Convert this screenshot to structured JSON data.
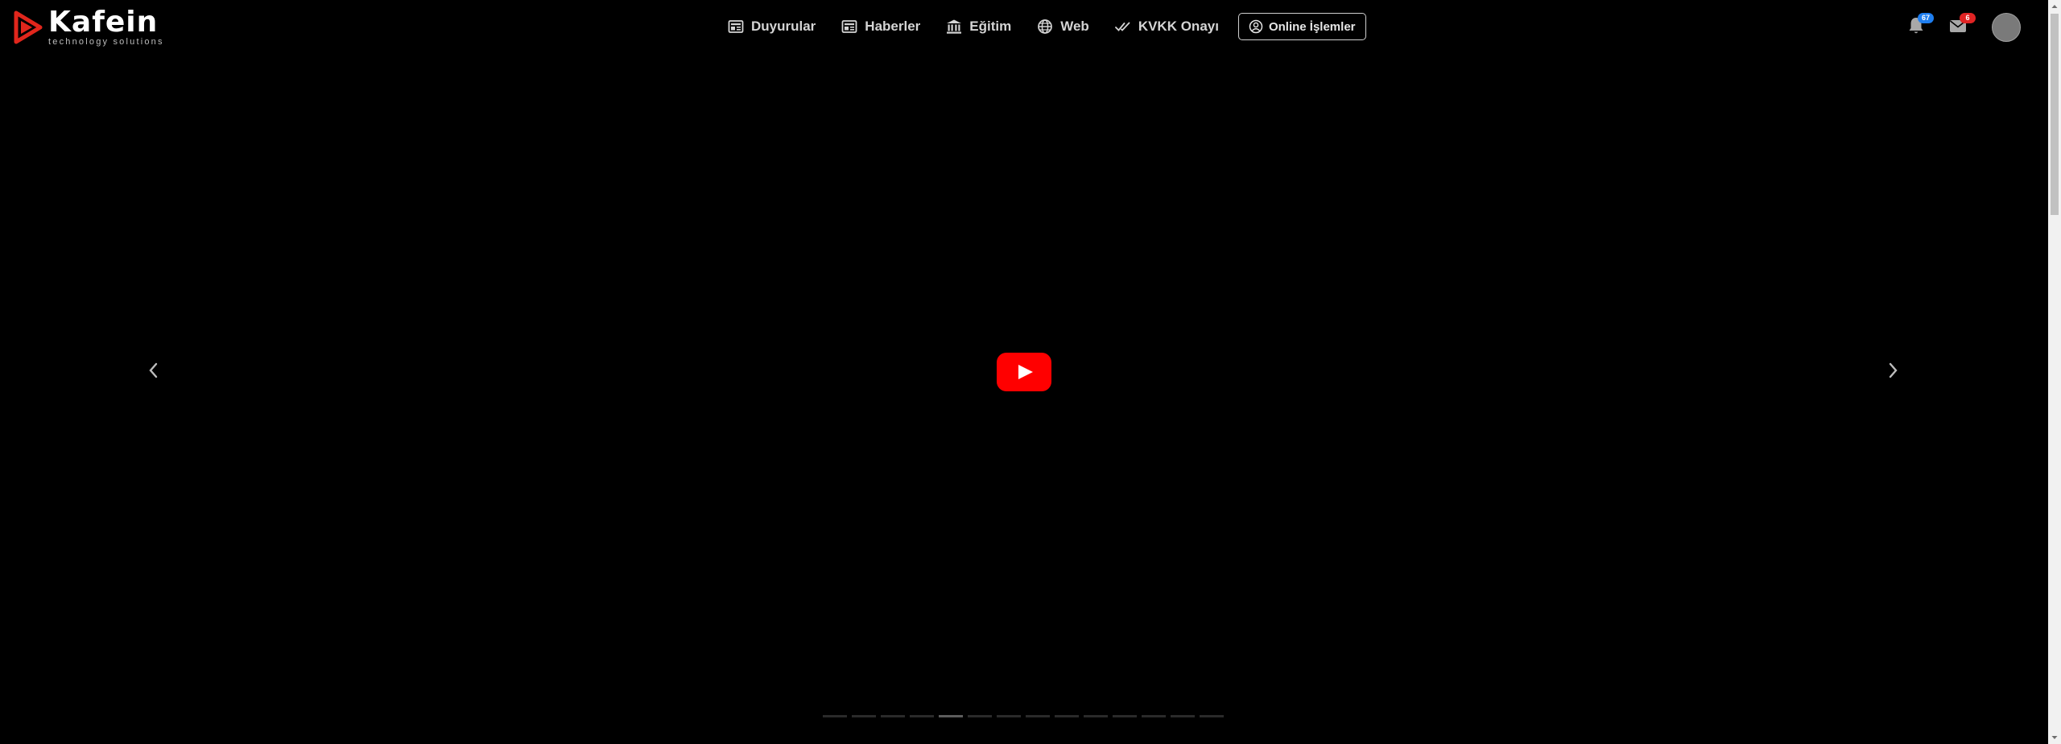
{
  "brand": {
    "name": "Kafein",
    "tagline": "technology solutions",
    "accent": "#e1261c"
  },
  "nav": [
    {
      "label": "Duyurular",
      "icon": "newspaper-icon"
    },
    {
      "label": "Haberler",
      "icon": "newspaper-icon"
    },
    {
      "label": "Eğitim",
      "icon": "institution-icon"
    },
    {
      "label": "Web",
      "icon": "globe-icon"
    },
    {
      "label": "KVKK Onayı",
      "icon": "double-check-icon"
    }
  ],
  "online_button": {
    "label": "Online İşlemler",
    "icon": "user-circle-icon"
  },
  "notifications": {
    "icon": "bell-icon",
    "count": "67",
    "badge_color": "#1e7ef0"
  },
  "messages": {
    "icon": "envelope-icon",
    "count": "6",
    "badge_color": "#e02424"
  },
  "slider": {
    "video_button": "youtube-play-icon",
    "slide_count": 14,
    "active_slide": 5
  }
}
